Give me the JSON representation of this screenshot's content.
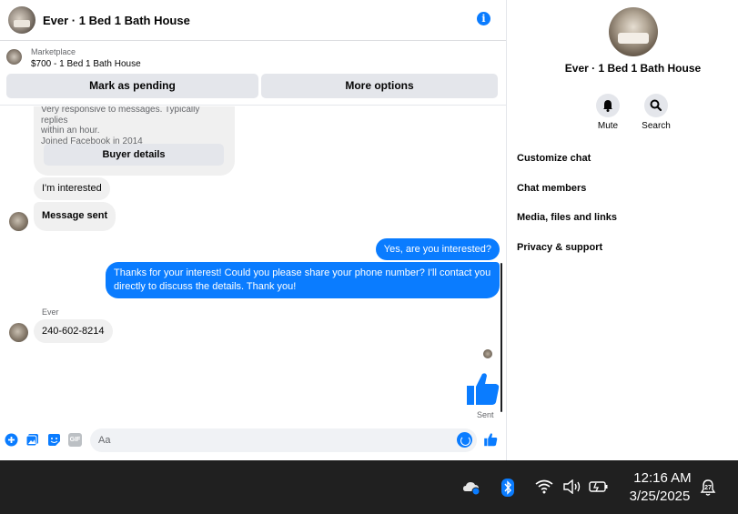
{
  "header": {
    "title": "Ever · 1 Bed 1 Bath House",
    "info_icon": "i"
  },
  "marketplace": {
    "label": "Marketplace",
    "listing": "$700 - 1 Bed 1 Bath House",
    "mark_pending": "Mark as pending",
    "more_options": "More options"
  },
  "card": {
    "line1": "Very responsive to messages. Typically replies",
    "line2": "within an hour.",
    "line3": "Joined Facebook in 2014",
    "button": "Buyer details"
  },
  "messages": {
    "m1": "I'm interested",
    "m2": "Message sent",
    "m3": "Yes, are you interested?",
    "m4": "Thanks for your interest! Could you please share your phone number? I'll contact you directly to discuss the details. Thank you!",
    "sender": "Ever",
    "m5": "240-602-8214",
    "status": "Sent"
  },
  "composer": {
    "placeholder": "Aa",
    "gif": "GIF"
  },
  "details": {
    "title": "Ever · 1 Bed 1 Bath House",
    "mute": "Mute",
    "search": "Search",
    "menu": [
      "Customize chat",
      "Chat members",
      "Media, files and links",
      "Privacy & support"
    ]
  },
  "taskbar": {
    "time": "12:16 AM",
    "date": "3/25/2025",
    "notification_count": "27"
  },
  "colors": {
    "accent": "#0a7cff",
    "taskbar": "#202020"
  }
}
